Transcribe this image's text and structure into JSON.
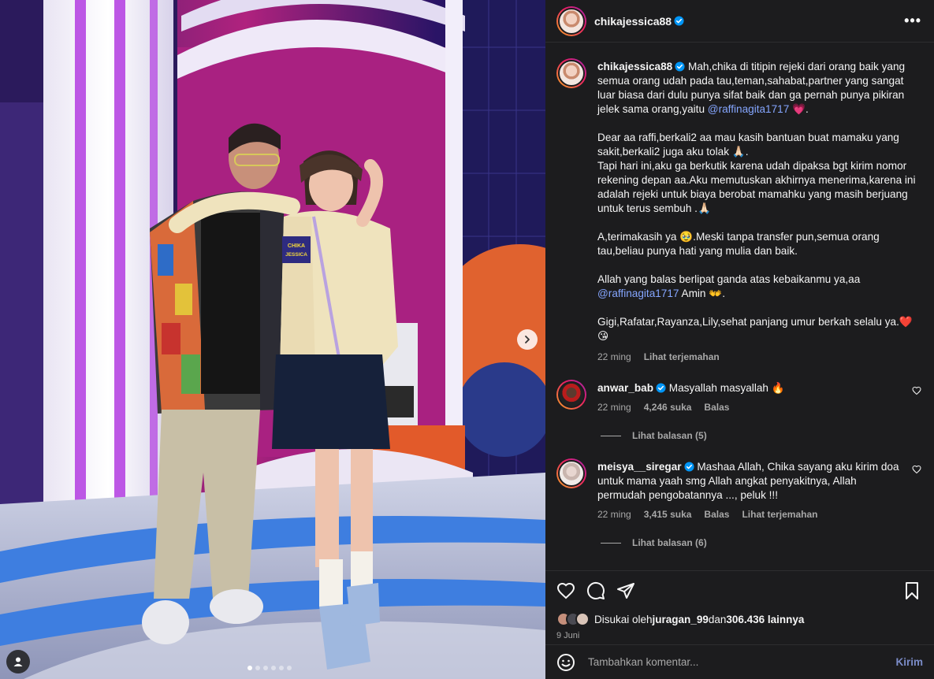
{
  "post": {
    "username": "chikajessica88",
    "more_label": "•••",
    "caption": {
      "p1_a": "Mah,chika di titipin rejeki dari orang baik yang semua orang udah pada tau,teman,sahabat,partner yang sangat luar biasa dari dulu punya sifat baik dan ga pernah punya pikiran jelek sama orang,yaitu ",
      "p1_mention": "@raffinagita1717",
      "p1_b": " 💗.",
      "p2": "Dear aa raffi,berkali2 aa mau kasih bantuan buat mamaku yang sakit,berkali2 juga aku tolak 🙏🏻.\nTapi hari ini,aku ga berkutik karena udah dipaksa bgt kirim nomor rekening depan aa.Aku memutuskan akhirnya menerima,karena ini adalah rejeki untuk biaya berobat mamahku yang masih berjuang untuk terus sembuh .🙏🏻",
      "p3": "A,terimakasih ya 🥹.Meski tanpa transfer pun,semua orang tau,beliau punya hati yang mulia dan baik.",
      "p4_a": "Allah yang balas berlipat ganda atas kebaikanmu ya,aa ",
      "p4_mention": "@raffinagita1717",
      "p4_b": " Amin 👐.",
      "p5": "Gigi,Rafatar,Rayanza,Lily,sehat panjang umur berkah selalu ya.❤️\n😘",
      "time": "22 ming",
      "translate": "Lihat terjemahan"
    },
    "likes_prefix": "Disukai oleh ",
    "likes_user": "juragan_99",
    "likes_mid": " dan ",
    "likes_count": "306.436 lainnya",
    "date": "9 Juni"
  },
  "comments": [
    {
      "username": "anwar_bab",
      "text": "Masyallah masyallah 🔥",
      "time": "22 ming",
      "likes": "4,246 suka",
      "reply": "Balas",
      "view_replies": "Lihat balasan (5)"
    },
    {
      "username": "meisya__siregar",
      "text": "Mashaa Allah, Chika sayang aku kirim doa untuk mama yaah smg Allah angkat penyakitnya, Allah permudah pengobatannya ..., peluk !!!",
      "time": "22 ming",
      "likes": "3,415 suka",
      "reply": "Balas",
      "translate": "Lihat terjemahan",
      "view_replies": "Lihat balasan (6)"
    }
  ],
  "photo": {
    "name_tag_line1": "CHIKA",
    "name_tag_line2": "JESSICA",
    "carousel_count": 6,
    "carousel_active": 0
  },
  "composer": {
    "placeholder": "Tambahkan komentar...",
    "post_label": "Kirim"
  },
  "icons": {
    "header": [
      "verified-icon",
      "more-icon"
    ],
    "actions": [
      "heart-icon",
      "comment-icon",
      "share-icon",
      "bookmark-icon"
    ],
    "composer": [
      "emoji-icon"
    ],
    "media": [
      "chevron-right-icon",
      "user-tag-icon"
    ]
  },
  "colors": {
    "panel_bg": "#1c1c1e",
    "mention": "#85a6ff",
    "muted": "#a8a8a8",
    "verified": "#0095f6",
    "post_button": "#7b8cc8"
  }
}
